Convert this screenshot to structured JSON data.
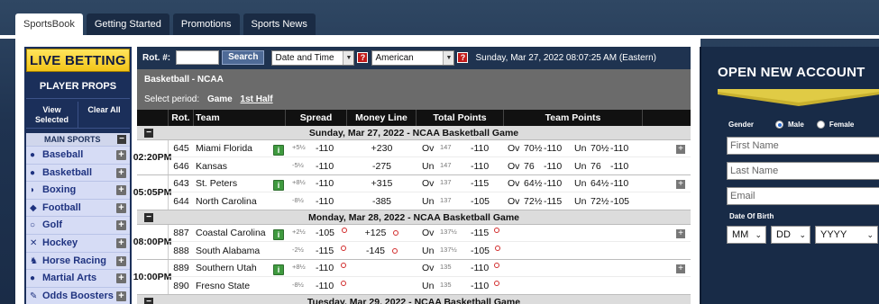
{
  "tabs": [
    "SportsBook",
    "Getting Started",
    "Promotions",
    "Sports News"
  ],
  "sidebar": {
    "live_betting": "LIVE BETTING",
    "player_props": "PLAYER PROPS",
    "view_selected": "View Selected",
    "clear_all": "Clear All",
    "main_sports": "MAIN SPORTS",
    "items": [
      {
        "label": "Baseball",
        "icon": "baseball-icon",
        "glyph": "●"
      },
      {
        "label": "Basketball",
        "icon": "basketball-icon",
        "glyph": "●"
      },
      {
        "label": "Boxing",
        "icon": "boxing-icon",
        "glyph": "◗"
      },
      {
        "label": "Football",
        "icon": "football-icon",
        "glyph": "◆"
      },
      {
        "label": "Golf",
        "icon": "golf-icon",
        "glyph": "○"
      },
      {
        "label": "Hockey",
        "icon": "hockey-icon",
        "glyph": "✕"
      },
      {
        "label": "Horse Racing",
        "icon": "horse-racing-icon",
        "glyph": "♞"
      },
      {
        "label": "Martial Arts",
        "icon": "martial-arts-icon",
        "glyph": "●"
      },
      {
        "label": "Odds Boosters",
        "icon": "odds-boosters-icon",
        "glyph": "✎"
      }
    ]
  },
  "toolbar": {
    "rot_label": "Rot. #:",
    "search_label": "Search",
    "sort_select": "Date and Time",
    "odds_select": "American",
    "date": "Sunday, Mar 27, 2022 08:07:25 AM (Eastern)",
    "help": "?"
  },
  "panel": {
    "league": "Basketball - NCAA",
    "period_label": "Select period:",
    "period_game": "Game",
    "period_half": "1st Half"
  },
  "columns": {
    "rot": "Rot.",
    "team": "Team",
    "spread": "Spread",
    "moneyline": "Money Line",
    "total": "Total Points",
    "team_points": "Team Points"
  },
  "dates": {
    "d1": "Sunday, Mar 27, 2022 - NCAA Basketball Game",
    "d2": "Monday, Mar 28, 2022 - NCAA Basketball Game",
    "d3": "Tuesday, Mar 29, 2022 - NCAA Basketball Game"
  },
  "games": [
    {
      "time": "02:20",
      "ampm": "PM",
      "teams": [
        {
          "rot": "645",
          "team": "Miami Florida",
          "sp_line": "+5½",
          "sp_odds": "-110",
          "ml": "+230",
          "tp_ou": "Ov",
          "tp_pts": "147",
          "tp_odds": "-110",
          "tpp_ou1": "Ov",
          "tpp_pt1": "70½",
          "tpp_o1": "-110",
          "tpp_ou2": "Un",
          "tpp_pt2": "70½",
          "tpp_o2": "-110"
        },
        {
          "rot": "646",
          "team": "Kansas",
          "sp_line": "-5½",
          "sp_odds": "-110",
          "ml": "-275",
          "tp_ou": "Un",
          "tp_pts": "147",
          "tp_odds": "-110",
          "tpp_ou1": "Ov",
          "tpp_pt1": "76",
          "tpp_o1": "-110",
          "tpp_ou2": "Un",
          "tpp_pt2": "76",
          "tpp_o2": "-110"
        }
      ]
    },
    {
      "time": "05:05",
      "ampm": "PM",
      "teams": [
        {
          "rot": "643",
          "team": "St. Peters",
          "sp_line": "+8½",
          "sp_odds": "-110",
          "ml": "+315",
          "tp_ou": "Ov",
          "tp_pts": "137",
          "tp_odds": "-115",
          "tpp_ou1": "Ov",
          "tpp_pt1": "64½",
          "tpp_o1": "-110",
          "tpp_ou2": "Un",
          "tpp_pt2": "64½",
          "tpp_o2": "-110"
        },
        {
          "rot": "644",
          "team": "North Carolina",
          "sp_line": "-8½",
          "sp_odds": "-110",
          "ml": "-385",
          "tp_ou": "Un",
          "tp_pts": "137",
          "tp_odds": "-105",
          "tpp_ou1": "Ov",
          "tpp_pt1": "72½",
          "tpp_o1": "-115",
          "tpp_ou2": "Un",
          "tpp_pt2": "72½",
          "tpp_o2": "-105"
        }
      ]
    },
    {
      "time": "08:00",
      "ampm": "PM",
      "teams": [
        {
          "rot": "887",
          "team": "Coastal Carolina",
          "sp_line": "+2½",
          "sp_odds": "-105",
          "ml": "+125",
          "tp_ou": "Ov",
          "tp_pts": "137½",
          "tp_odds": "-115",
          "tpp_ou1": "",
          "tpp_pt1": "",
          "tpp_o1": "",
          "tpp_ou2": "",
          "tpp_pt2": "",
          "tpp_o2": ""
        },
        {
          "rot": "888",
          "team": "South Alabama",
          "sp_line": "-2½",
          "sp_odds": "-115",
          "ml": "-145",
          "tp_ou": "Un",
          "tp_pts": "137½",
          "tp_odds": "-105",
          "tpp_ou1": "",
          "tpp_pt1": "",
          "tpp_o1": "",
          "tpp_ou2": "",
          "tpp_pt2": "",
          "tpp_o2": ""
        }
      ]
    },
    {
      "time": "10:00",
      "ampm": "PM",
      "teams": [
        {
          "rot": "889",
          "team": "Southern Utah",
          "sp_line": "+8½",
          "sp_odds": "-110",
          "ml": "",
          "tp_ou": "Ov",
          "tp_pts": "135",
          "tp_odds": "-110",
          "tpp_ou1": "",
          "tpp_pt1": "",
          "tpp_o1": "",
          "tpp_ou2": "",
          "tpp_pt2": "",
          "tpp_o2": ""
        },
        {
          "rot": "890",
          "team": "Fresno State",
          "sp_line": "-8½",
          "sp_odds": "-110",
          "ml": "",
          "tp_ou": "Un",
          "tp_pts": "135",
          "tp_odds": "-110",
          "tpp_ou1": "",
          "tpp_pt1": "",
          "tpp_o1": "",
          "tpp_ou2": "",
          "tpp_pt2": "",
          "tpp_o2": ""
        }
      ]
    }
  ],
  "account": {
    "title": "OPEN NEW ACCOUNT",
    "gender": "Gender",
    "male": "Male",
    "female": "Female",
    "first_name": "First Name",
    "last_name": "Last Name",
    "email": "Email",
    "dob": "Date Of Birth",
    "mm": "MM",
    "dd": "DD",
    "yyyy": "YYYY"
  }
}
